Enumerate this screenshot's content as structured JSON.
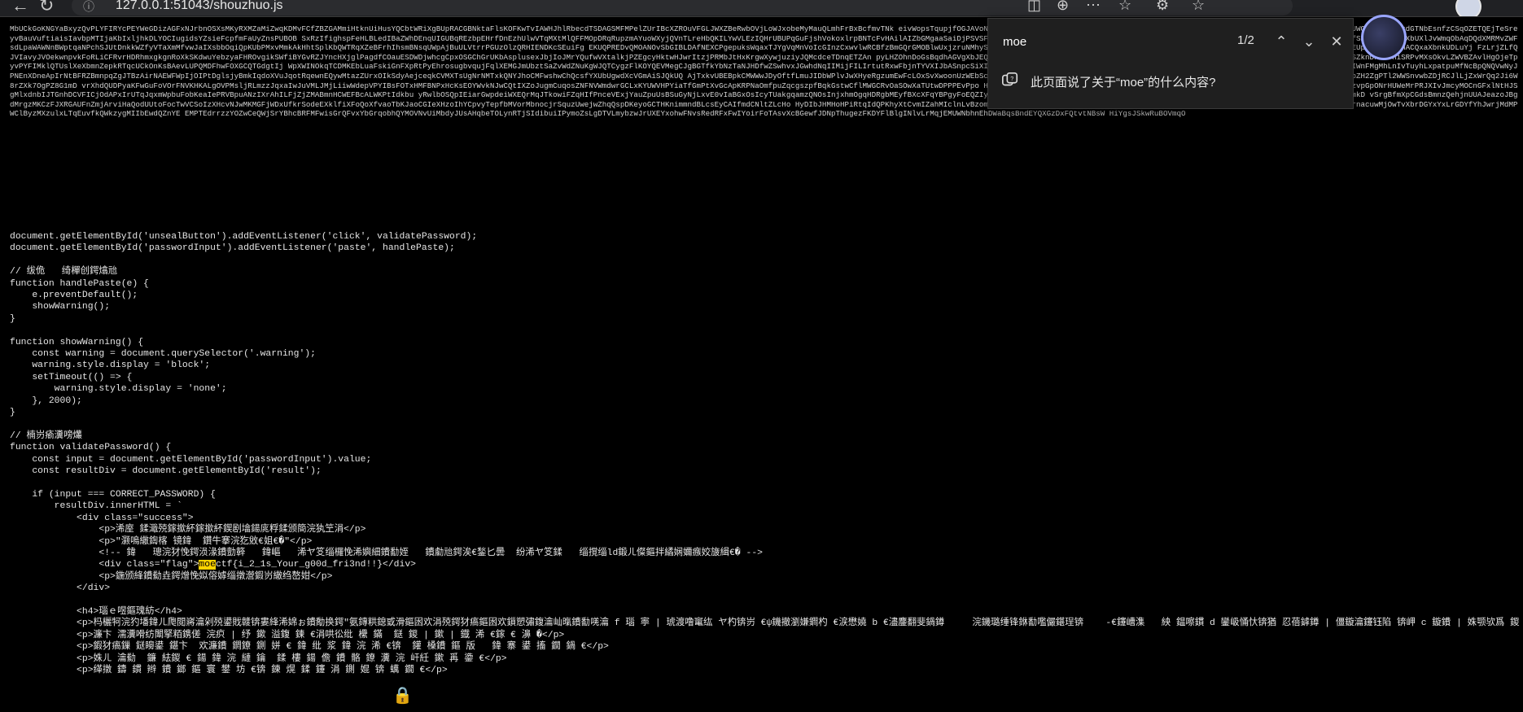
{
  "browser": {
    "url": "127.0.0.1:51043/shouzhuo.js",
    "icons": [
      "back-icon",
      "refresh-icon",
      "lock-icon",
      "translate-icon",
      "zoom-icon",
      "more-icon",
      "favorite-icon",
      "extension-icon",
      "collections-icon",
      "profile-avatar"
    ]
  },
  "find_bar": {
    "query": "moe",
    "count": "1/2",
    "copilot_prompt": "此页面说了关于“moe”的什么内容?"
  },
  "blob_text": "MbUCkGoKNGYaBxyzQvPLYFIRYcPEYWeGDizAGFxNJrbnOSXsMKyRXMZaMiZwqKDMvFCfZBZGAMmiHtknUiHusYQCbtWRiXgBUpRACGBNktaFlsKOFKwTvIAWHJhlRbecdTSDAGSMFMPelZUrIBcXZROuVFGLJWXZBeRwbOVjLoWJxobeMyMauQLmhFrBxBcfmvTNk eivWopsTqupjfOGJAVoNYFeYfLwfigZlveresIgMqxIgaBxEtSygjfmJVwFvXIsLBPtzRvigznXqGWJKJUNPIsFjfAUIGNcrvrstCUWOGJYMKNXtxdGTNbEsnfzCSqOZETQEjTeSreyvBauVuftiaisIavbpMTIjaKbIxljhkDLYOCIugidsYZsieFcpfmFaUyZnsPUBOB SxRzIfighspFeHLBLedIBaZWhDEnqUIGUBqREzbpEHrfDnEzhUlwVTqMXtMlQFFMOpDRqRupzmAYuoWXyjQVnTLreHbQKILYwVLEzIQHrUBUPqGuFjshVokoxlrpBNTcFvHAilAIZbGMgaaSaiDjPSVSFGjCVhWmzuEKbXUbkXWYDqKWaSVYLkpeWMZzmulvPcNeL FYExgrkxYvNeaHL7iekKuSSrJiMTtHOkXbeJfSMOVhdbGxQNXbUXlJvWmqObAqDQdXMRMvZWFsdLpaWAWNnBWptqaNPchSJUtDnkkWZfyVTaXmMfvwJaIXsbbOqiQpKUbPMxvMmkAkHhtSplKbQWTRqXZeBFrhIhsmBNsqUWpAjBuULVtrrPGUzOlzQRHIENDKcSEuiFg EKUQPREDvQMOANOvSbGIBLDAfNEXCPgepuksWqaxTJYgVqMnVoIcGInzCxwvlwRCBfzBmGQrGMOBlwUxjzruNMhyShnFiXzPVfgYemuRoMZXdZboTdTfVBXpZkiTgjGwurPsvWXMUTbJoYigvpbVbDIRTNsRmMlBYzQKfVosFoEUpGVVZcHubnACQxaXbnkUDLuYj FzLrjZLfQJVIavyJVOekwnpvkFoRLiCFRvrHDRhmxgkgnRoXkSKdwuYebzyaFHROvgikSWfiBYGvRZJYncHXjglPagdfCOauESDWDjwhcgCpxOSGChGrUKbAsplusexJbjIoJMrYQufwVXtalkjPZEgcyHktwHJwrItzjPRMbJtHxKrgwXywjuziyJQMcdceTDnqETZAn pyLHZOhnDoGsBqdhAGVgXbJEQsrQVebxvHsLfDzgvrMxuzJaSckybUnjQFfvhqtoDkOzrowDytYZpTNFLpjnQyoDQSwJoivLdueqzSCXdISZknDxvfvhiSRPvMXsOkvLZWVBZAvlHgOjeTpyvPYFIMklQTUslXeXbmnZepkRTqcUCkOnKsBAevLUPQMDFhwFOXGCQTGdgtIj WpXWINOkqTCDMKEbLuaFskiGnFXpRtPyEhrosugbvqujFqlXEMGJmUbztSaZvWdZNuKgWJQTCygzFlKOYQEVMegCJgBGTfkYbNzTaNJHDfwZSwhvxJGwhdNqIIMijFILIrtutRxwFbjnTYVXIJbASnpcSiXIzxDOSLmrMgliyhcvOnueSIUDKCEwvgapqdQIeabiLplDxUFSvBAyTHmAAgkqu OgzHTQEoFZloPQsXTiSIWnFMgMhLnIvTuyhLxpatpuMfNcBpQNQVwNyJPNEnXDneApIrNtBFRZBmnpqZgJTBzAirNAEWFWpIjOIPtDglsjyBmkIqdoXVuJqotRqewnEQywMtazZUrxOIkSdyAejceqkCVMXTsUgNrNMTxkQNYJhoCMFwshwChQcsfYXUbUgwdXcVGmAiSJQkUQ AjTxkvUBEBpkCMWWwJDyOftfLmuJIDbWPlvJwXHyeRgzumEwFcLOxSvXwoonUzWEbScnFHHCJgNYrzoRHOpOdtznXRwhokWRZrUxVCNMXxeRTvRSnrNTasMwONlvqSNSuuqCiHeQKRgaluzJ6jT8bZH2ZgPTl2WWSnvwbZDjRCJlLjZxWrQq2Ji6W8rZXk7OgPZ8G1mD vrXhdQUDPyaKFwGuFoVOrFNVKHKALgOVPMsljRLmzzJqxaIwJuVMLJMjLiiwWdepVPYIBsFOTxHMFBNPxHcKsEOYWvkNJwCQtIXZoJugmCuqosZNFNVWmdwrGCLxKYUWVHPYiaTfGmPtXvGcApKRPNaOmfpuZqcgszpfBqkGstwCflMWGCRvOaSOwXaTUtwDPPPEvPpo HvmvtaRvOPdCyEvKSNfgfcVNGmcpSxLfdqSuGeBQzWvgqYMjWrSbvUvKHfDWgLpvuLXrbyKHDZwcAxCbLAzvpGpONrHUWeMrPRJXIvJmcyMOCnGFxlNtHJSgMlxdnbIJTGnhDCVFICjOdAPxIrUTqJqxmWpbuFobKeaIePRVBpuANzIXrAhILFjZjZMABmnHCWEFBcALWKPtIdkbu yRwlbOSQpIEiarGwpdeiWXEQrMqJTkowiFZqHIfPnceVExjYauZpuUsBSuGyNjLxvE0vIaBGxOsIcyTUakgqamzQNOsInjxhmOgqHDRgbMEyfBXcXFqYBPgyFoEQZIyarztAoWVXITSHqkepdgiPMzPdZnIbhzKBPHZBeTSsmgMgMEgZgDaxAQJfXRtqJzgHgENdIXPMdHCodRBQmkD vSrgBfmXpCGdsBmnzQehjnUUAJeazoJBgdMrgzMKCzFJXRGAUFnZmjArviHaQodUUtoFocTwVCSoIzXHcvNJwMKMGFjWDxUfkrSodeEXklfiXFoQoXfvaoTbKJaoCGIeXHzoIhYCpvyTepfbMVorMbnocjrSquzUwejwZhqQspDKeyoGCTHKnimmndBLcsEyCAIfmdCNltZLcHo HyDIbJHMHoHPiRtqIdQPKhyXtCvmIZahMIclnLvBzomRnNjOXCxeLEMCOtFyRxLFyadousnEPruTbQaXyHruWUaezxmRupaIUsxapBoikqzfzyIMciQuYdhdzIlbrnacuwMjOwTvXbrDGYxYxLrGDYfYhJwrjMdMPWClByzMXzulxLTqEuvfkQWkzygMIIbEwdQZnYE EMPTEdrrzzYOZwCeQWjSrYBhcBRFMFwisGrQFvxYbGrqobhQYMOVNvUiMbdyJUsAHqbeTOLynRTjSIdibuiIPymoZsLgDTVLmybzwJrUXEYxohwFNvsRedRFxFwIYoirFoTAsvXcBGewfJDNpThugezFKDYFlBlgINlvLrMqjEMUWNbhnEhDWaBqsBndEYQXGzDxFQtvtNBsW HiYgsJSkwRuBOVmqO",
  "code_lines": [
    "document.getElementById('unsealButton').addEventListener('click', validatePassword);",
    "document.getElementById('passwordInput').addEventListener('paste', handlePaste);",
    "",
    "// 绂佹   绮樿创鍔熻兘",
    "function handlePaste(e) {",
    "    e.preventDefault();",
    "    showWarning();",
    "}",
    "",
    "function showWarning() {",
    "    const warning = document.querySelector('.warning');",
    "    warning.style.display = 'block';",
    "    setTimeout(() => {",
    "        warning.style.display = 'none';",
    "    }, 2000);",
    "}",
    "",
    "// 楠岃瘉瀵嗙爜",
    "function validatePassword() {",
    "    const input = document.getElementById('passwordInput').value;",
    "    const resultDiv = document.getElementById('result');",
    "",
    "    if (input === CORRECT_PASSWORD) {",
    "        resultDiv.innerHTML = `",
    "            <div class=\"success\">",
    "                <p>浠庢 鍒濈殑鎵撳紑鎵撳紑鍥剧墖鍚庣粰鍒颁簡浣犱笁涓</p>",
    "                <p>\"灏嗚繖鍧楁 镜鍏  鑽牛搴浣犵敓€姐€�\"</p>",
    "                <!-- 鍏   璁浣犲悗鍔涢湪鐨勯簳   鍏嶇   浠ヤ笅缁欏悗浠嬩細鐨勫姪   鐨勮兘鍔涘€鍫匕曇  纷浠ヤ笅鍒   缁撹缁ld鍛ㄦ儏鏂拌繘娴嬭瘯姣旇緝€� -->",
    "                <div class=\"flag\">moectf{i_2_1s_Your_g00d_fri3nd!!}</div>",
    "                <p>鍦颁綘鐨勬垚鍔熷悗姒傛嫭缁撴瀯鍜岃繖绉嶅姏</p>",
    "            </div>",
    "",
    "            <h4>瑙ｅ喅鏂瑰紡</h4>",
    "            <p>杩欐牱浣犳墦鍏ㄦ爮閲嶈瀹剁殑鍙戝竷锛婁綘浠婂ぉ鐨勪换鍔″氨鏄粠鎴戜滑鏂囦欢涓殑鍔犲瘑鏂囦欢鎻愬彇鍑瀹屾暣鐨勫唴瀹 f 瑙 寕 | 琥渡噜竃纮 ヤ杓锛岃 €ψ鐖撤瀏嫌鐧杓 €涙懋嬈 b €濜鏖翻斐鍋鐏     浣鐖璐缍锋銝勫嚂儼鍖珵锛    -€鑳嶆潗   紻 鎾嚓鏆 d 鑾岋悀忕锛猶 忍蓓鎼鐏 | 僵鏇瀹鑳钰陷 锛岬 c 鏇鐨 | 姝颚欤爲 鍐 | 鐨 浠欢  €锕 �</p>",
    "            <p>濂卞 濡瀵嗗纺闈掔粨鎸傞 浣疻 | 纾 鏉 溢鍑 鍊 €涓哄彸纰 欙 鏋  鎹 鍐 | 鏉 | 鐡 浠 €鎵 € 濞 �</p>",
    "            <p>鍜犲瘑鏁 鎹矈鍙 鍖卞  欢濂鐨 鐧鐐 鍘 姘 € 鍏 纰 浆 鍏 浣 浠 €锛  鑵 槡鐨 鏂 版   鍏 寨 鍙 搐 鐗 鍋 €</p>",
    "            <p>姝ㄦ 瀹勬  鐮 紶鍐 € 鍚 鍏 浣 縺 鑰  鍒 樓 鍚 儋 鐨 骼 鐐 瀵 浣 屽紝 鏉 爯 鍌 €</p>",
    "            <p>缂撴 鑄 鏆 辫 鐨 鎯 鏂 寰 鐢 坊 €锛 鍊 熀 鍒 鑳 涓 鍘 婫 锛 蠇 鐗 €</p>"
  ]
}
